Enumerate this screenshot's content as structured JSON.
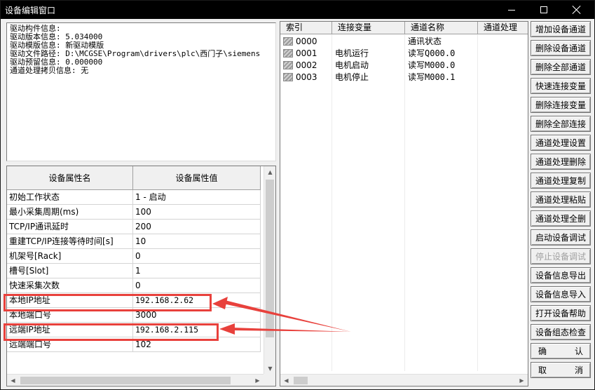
{
  "window": {
    "title": "设备编辑窗口"
  },
  "driver_info": {
    "lines": [
      "驱动构件信息:",
      "驱动版本信息: 5.034000",
      "驱动模版信息: 新驱动模版",
      "驱动文件路径: D:\\MCGSE\\Program\\drivers\\plc\\西门子\\siemens",
      "驱动预留信息: 0.000000",
      "通道处理拷贝信息: 无"
    ]
  },
  "props": {
    "headers": {
      "name": "设备属性名",
      "value": "设备属性值"
    },
    "rows": [
      {
        "name": "初始工作状态",
        "value": "1 - 启动"
      },
      {
        "name": "最小采集周期(ms)",
        "value": "100"
      },
      {
        "name": "TCP/IP通讯延时",
        "value": "200"
      },
      {
        "name": "重建TCP/IP连接等待时间[s]",
        "value": "10"
      },
      {
        "name": "机架号[Rack]",
        "value": "0"
      },
      {
        "name": "槽号[Slot]",
        "value": "1"
      },
      {
        "name": "快速采集次数",
        "value": "0"
      },
      {
        "name": "本地IP地址",
        "value": "192.168.2.62"
      },
      {
        "name": "本地端口号",
        "value": "3000"
      },
      {
        "name": "远端IP地址",
        "value": "192.168.2.115"
      },
      {
        "name": "远端端口号",
        "value": "102"
      }
    ]
  },
  "channels": {
    "headers": {
      "index": "索引",
      "variable": "连接变量",
      "name": "通道名称",
      "process": "通道处理"
    },
    "rows": [
      {
        "index": "0000",
        "variable": "",
        "name": "通讯状态"
      },
      {
        "index": "0001",
        "variable": "电机运行",
        "name": "读写Q000.0"
      },
      {
        "index": "0002",
        "variable": "电机启动",
        "name": "读写M000.0"
      },
      {
        "index": "0003",
        "variable": "电机停止",
        "name": "读写M000.1"
      }
    ]
  },
  "buttons": {
    "add_device_channel": "增加设备通道",
    "delete_device_channel": "删除设备通道",
    "delete_all_channels": "删除全部通道",
    "quick_link_variable": "快速连接变量",
    "delete_link_variable": "删除连接变量",
    "delete_all_links": "删除全部连接",
    "channel_process_settings": "通道处理设置",
    "channel_process_delete": "通道处理删除",
    "channel_process_copy": "通道处理复制",
    "channel_process_paste": "通道处理粘贴",
    "channel_process_delete_all": "通道处理全删",
    "start_device_debug": "启动设备调试",
    "stop_device_debug": "停止设备调试",
    "export_device_info": "设备信息导出",
    "import_device_info": "设备信息导入",
    "open_device_help": "打开设备帮助",
    "device_config_check": "设备组态检查",
    "confirm_left": "确",
    "confirm_right": "认",
    "cancel_left": "取",
    "cancel_right": "消"
  },
  "colors": {
    "highlight": "#e8413c",
    "titlebar": "#000000",
    "window_bg": "#f0f0f0"
  }
}
